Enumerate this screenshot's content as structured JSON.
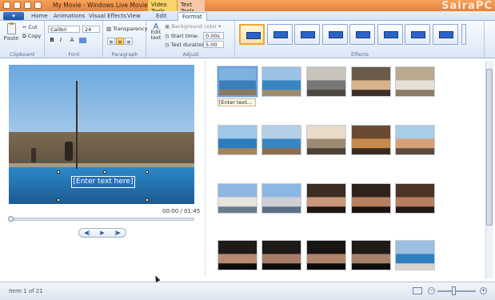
{
  "window": {
    "title": "My Movie - Windows Live Movie Maker",
    "context_tabs": [
      "Video Tools",
      "Text Tools"
    ],
    "watermark": "SairaPC"
  },
  "tabs": [
    "Home",
    "Animations",
    "Visual Effects",
    "View",
    "Edit",
    "Format"
  ],
  "active_tab": "Format",
  "ribbon": {
    "clipboard": {
      "paste": "Paste",
      "cut": "Cut",
      "copy": "Copy",
      "label": "Clipboard"
    },
    "font": {
      "family": "Calibri",
      "size": "24",
      "bold": "B",
      "italic": "I",
      "grow": "A",
      "label": "Font"
    },
    "paragraph": {
      "transparency": "Transparency",
      "label": "Paragraph"
    },
    "adjust": {
      "edit_text": "Edit text",
      "background_color": "Background color",
      "start_time_label": "Start time:",
      "start_time_value": "0.00s",
      "text_duration_label": "Text duration:",
      "text_duration_value": "5.00",
      "label": "Adjust"
    },
    "effects": {
      "label": "Effects",
      "count": 9,
      "selected_index": 0
    }
  },
  "preview": {
    "caption_text": "[Enter text here]",
    "timecode": "00:00 / 01:45"
  },
  "storyboard": {
    "first_caption": "[Enter text..."
  },
  "status": {
    "item_text": "Item 1 of 21"
  },
  "colors": {
    "title_bar": "#e9813b",
    "ribbon_bg": "#dce7f5",
    "selected_effect": "#f0a631"
  }
}
